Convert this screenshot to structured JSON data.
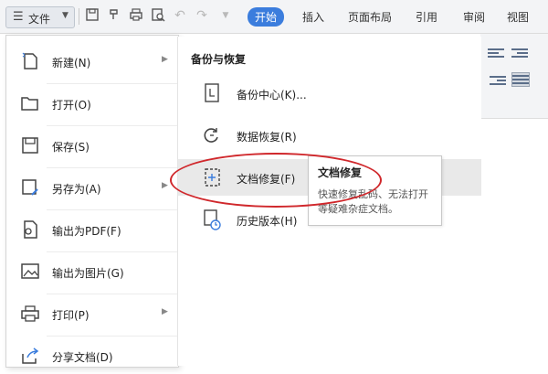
{
  "toolbar": {
    "file_label": "文件",
    "tabs": [
      "开始",
      "插入",
      "页面布局",
      "引用",
      "审阅",
      "视图"
    ],
    "active_tab": "开始"
  },
  "file_menu": {
    "items": [
      {
        "label": "新建(N)",
        "icon": "new-document-icon",
        "has_submenu": true
      },
      {
        "label": "打开(O)",
        "icon": "folder-open-icon",
        "has_submenu": false
      },
      {
        "label": "保存(S)",
        "icon": "save-icon",
        "has_submenu": false
      },
      {
        "label": "另存为(A)",
        "icon": "save-as-icon",
        "has_submenu": true
      },
      {
        "label": "输出为PDF(F)",
        "icon": "export-pdf-icon",
        "has_submenu": false
      },
      {
        "label": "输出为图片(G)",
        "icon": "export-image-icon",
        "has_submenu": false
      },
      {
        "label": "打印(P)",
        "icon": "printer-icon",
        "has_submenu": true
      },
      {
        "label": "分享文档(D)",
        "icon": "share-icon",
        "has_submenu": false
      }
    ]
  },
  "submenu": {
    "title": "备份与恢复",
    "items": [
      {
        "label": "备份中心(K)...",
        "icon": "backup-center-icon"
      },
      {
        "label": "数据恢复(R)",
        "icon": "data-recovery-icon"
      },
      {
        "label": "文档修复(F)",
        "icon": "document-repair-icon",
        "highlighted": true
      },
      {
        "label": "历史版本(H)",
        "icon": "history-version-icon"
      }
    ]
  },
  "tooltip": {
    "title": "文档修复",
    "description": "快速修复乱码、无法打开等疑难杂症文档。"
  },
  "colors": {
    "accent": "#3b7ddd",
    "annotation": "#d0282c",
    "highlight": "#e9e9e9"
  }
}
